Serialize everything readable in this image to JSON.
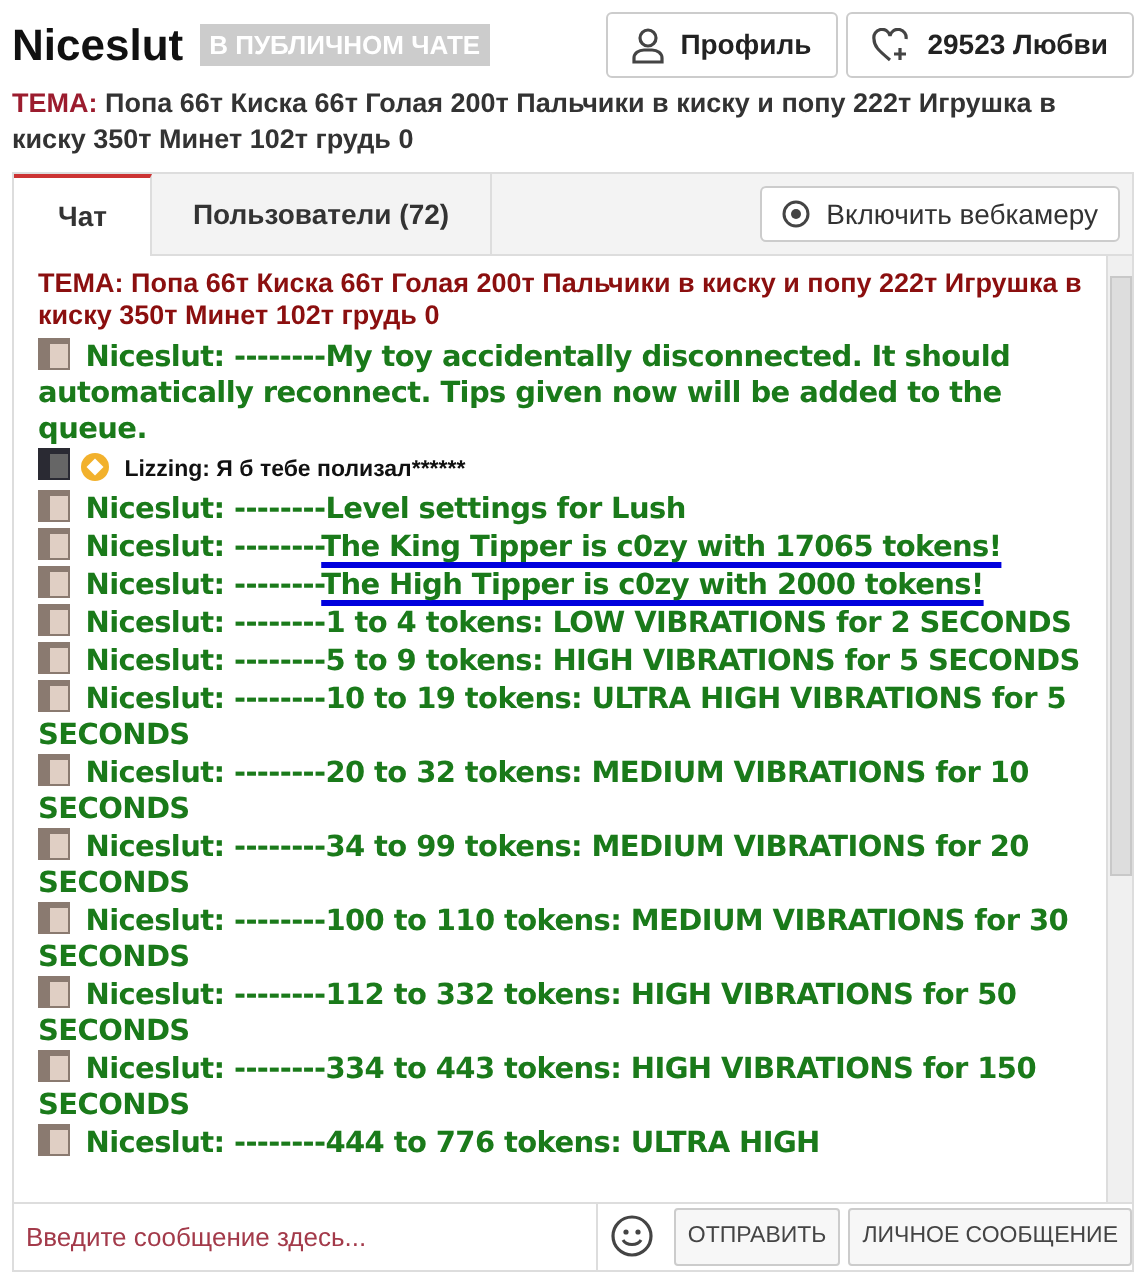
{
  "header": {
    "title": "Niceslut",
    "status_badge": "В ПУБЛИЧНОМ ЧАТЕ",
    "buttons": [
      {
        "kind": "profile",
        "label": "Профиль"
      },
      {
        "kind": "love",
        "label": "29523 Любви"
      }
    ]
  },
  "topic": {
    "label": "ТЕМА:",
    "text": "Попа 66т Киска 66т Голая 200т Пальчики в киску и попу 222т Игрушка в киску 350т Минет 102т грудь 0"
  },
  "tabs": [
    {
      "label": "Чат",
      "selected": true
    },
    {
      "label": "Пользователи (72)",
      "selected": false
    }
  ],
  "webcam_button": "Включить вебкамеру",
  "chat": {
    "topic": "ТЕМА: Попа 66т Киска 66т Голая 200т Пальчики в киску и попу 222т Игрушка в киску 350т Минет 102т грудь 0",
    "messages": [
      {
        "kind": "model",
        "author": "Niceslut:",
        "text": "--------My toy accidentally disconnected. It should automatically reconnect. Tips given now will be added to the queue."
      },
      {
        "kind": "user",
        "author": "Lizzing:",
        "text": "Я б тебе полизал******"
      },
      {
        "kind": "model",
        "author": "Niceslut:",
        "text": "--------Level settings for Lush"
      },
      {
        "kind": "model",
        "author": "Niceslut:",
        "text": "--------",
        "highlight": "The King Tipper is c0zy with 17065 tokens!"
      },
      {
        "kind": "model",
        "author": "Niceslut:",
        "text": "--------",
        "highlight": "The High Tipper is c0zy with 2000 tokens!"
      },
      {
        "kind": "model",
        "author": "Niceslut:",
        "text": "--------1 to 4 tokens: LOW VIBRATIONS for 2 SECONDS"
      },
      {
        "kind": "model",
        "author": "Niceslut:",
        "text": "--------5 to 9 tokens: HIGH VIBRATIONS for 5 SECONDS"
      },
      {
        "kind": "model",
        "author": "Niceslut:",
        "text": "--------10 to 19 tokens: ULTRA HIGH VIBRATIONS for 5 SECONDS"
      },
      {
        "kind": "model",
        "author": "Niceslut:",
        "text": "--------20 to 32 tokens: MEDIUM VIBRATIONS for 10 SECONDS"
      },
      {
        "kind": "model",
        "author": "Niceslut:",
        "text": "--------34 to 99 tokens: MEDIUM VIBRATIONS for 20 SECONDS"
      },
      {
        "kind": "model",
        "author": "Niceslut:",
        "text": "--------100 to 110 tokens: MEDIUM VIBRATIONS for 30 SECONDS"
      },
      {
        "kind": "model",
        "author": "Niceslut:",
        "text": "--------112 to 332 tokens: HIGH VIBRATIONS for 50 SECONDS"
      },
      {
        "kind": "model",
        "author": "Niceslut:",
        "text": "--------334 to 443 tokens: HIGH VIBRATIONS for 150 SECONDS"
      },
      {
        "kind": "model",
        "author": "Niceslut:",
        "text": "--------444 to 776 tokens: ULTRA HIGH"
      }
    ]
  },
  "composer": {
    "placeholder": "Введите сообщение здесь...",
    "buttons": [
      "ОТПРАВИТЬ",
      "ЛИЧНОЕ СООБЩЕНИЕ"
    ]
  }
}
